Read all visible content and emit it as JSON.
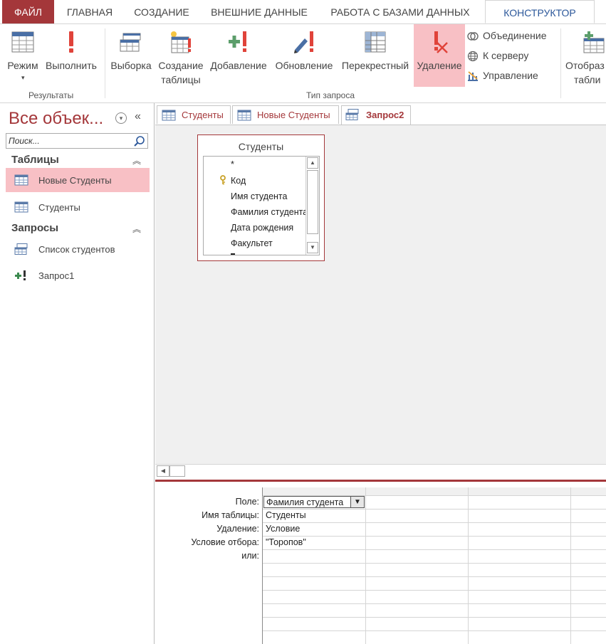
{
  "ribbon_tabs": [
    {
      "label": "ФАЙЛ"
    },
    {
      "label": "ГЛАВНАЯ"
    },
    {
      "label": "СОЗДАНИЕ"
    },
    {
      "label": "ВНЕШНИЕ ДАННЫЕ"
    },
    {
      "label": "РАБОТА С БАЗАМИ ДАННЫХ"
    },
    {
      "label": "КОНСТРУКТОР"
    }
  ],
  "ribbon": {
    "results": {
      "view_label": "Режим",
      "run_label": "Выполнить",
      "group_label": "Результаты"
    },
    "query_type": {
      "select_label": "Выборка",
      "make_table_label_1": "Создание",
      "make_table_label_2": "таблицы",
      "append_label": "Добавление",
      "update_label": "Обновление",
      "crosstab_label": "Перекрестный",
      "delete_label": "Удаление",
      "union_label": "Объединение",
      "passthrough_label": "К серверу",
      "ddl_label": "Управление",
      "group_label": "Тип запроса"
    },
    "show_table_label_1": "Отобраз",
    "show_table_label_2": "табли"
  },
  "nav": {
    "title": "Все объек...",
    "search_placeholder": "Поиск...",
    "tables_header": "Таблицы",
    "tables": [
      {
        "label": "Новые Студенты"
      },
      {
        "label": "Студенты"
      }
    ],
    "queries_header": "Запросы",
    "queries": [
      {
        "label": "Список студентов"
      },
      {
        "label": "Запрос1"
      }
    ]
  },
  "doc_tabs": [
    {
      "label": "Студенты"
    },
    {
      "label": "Новые Студенты"
    },
    {
      "label": "Запрос2"
    }
  ],
  "field_list": {
    "title": "Студенты",
    "fields": [
      "*",
      "Код",
      "Имя студента",
      "Фамилия студента",
      "Дата рождения",
      "Факультет"
    ]
  },
  "grid": {
    "row_labels": {
      "field": "Поле:",
      "table": "Имя таблицы:",
      "delete": "Удаление:",
      "criteria": "Условие отбора:",
      "or": "или:"
    },
    "col1": {
      "field": "Фамилия студента",
      "table": "Студенты",
      "delete": "Условие",
      "criteria": "\"Торопов\""
    }
  },
  "colors": {
    "accent": "#a4373a",
    "selected": "#f8c0c5",
    "link": "#2b579a"
  }
}
